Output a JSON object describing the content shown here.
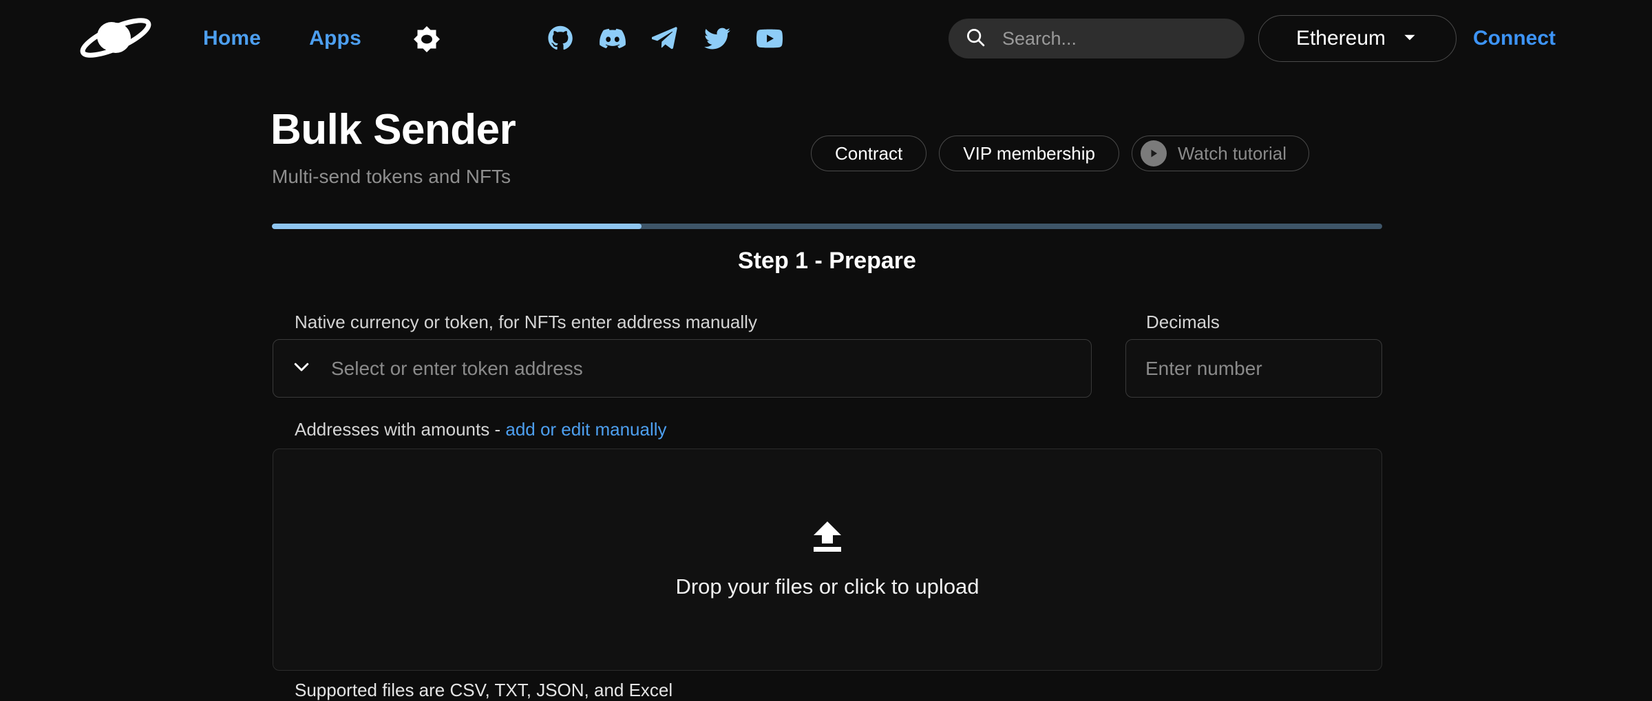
{
  "header": {
    "logo_name": "saturn-planet-logo",
    "nav": [
      {
        "label": "Home",
        "name": "nav-home"
      },
      {
        "label": "Apps",
        "name": "nav-apps"
      }
    ],
    "theme_toggle_icon": "brightness-icon",
    "socials": [
      {
        "name": "github-icon",
        "label": "GitHub"
      },
      {
        "name": "discord-icon",
        "label": "Discord"
      },
      {
        "name": "telegram-icon",
        "label": "Telegram"
      },
      {
        "name": "twitter-icon",
        "label": "Twitter"
      },
      {
        "name": "youtube-icon",
        "label": "YouTube"
      }
    ],
    "search": {
      "placeholder": "Search...",
      "value": "",
      "icon": "search-icon"
    },
    "chain": {
      "label": "Ethereum",
      "icon": "chevron-down-icon"
    },
    "connect_label": "Connect"
  },
  "page": {
    "title": "Bulk Sender",
    "subtitle": "Multi-send tokens and NFTs",
    "actions": [
      {
        "label": "Contract",
        "name": "contract-button"
      },
      {
        "label": "VIP membership",
        "name": "vip-membership-button"
      },
      {
        "label": "Watch tutorial",
        "name": "watch-tutorial-button",
        "icon": "play-icon"
      }
    ]
  },
  "progress": {
    "percent": 33,
    "percent_css": "33.3%"
  },
  "step": {
    "title": "Step 1 - Prepare"
  },
  "form": {
    "token": {
      "label": "Native currency or token, for NFTs enter address manually",
      "placeholder": "Select or enter token address",
      "value": "",
      "icon": "chevron-down-icon"
    },
    "decimals": {
      "label": "Decimals",
      "placeholder": "Enter number",
      "value": ""
    },
    "addresses": {
      "label_static": "Addresses with amounts - ",
      "label_link": "add or edit manually"
    },
    "dropzone": {
      "icon": "upload-icon",
      "text": "Drop your files or click to upload"
    },
    "supported": "Supported files are CSV, TXT, JSON, and Excel"
  },
  "colors": {
    "background": "#0d0d0d",
    "accent_blue": "#4d9fef",
    "progress_fill": "#8ec5f0",
    "progress_track": "#3e5568",
    "social_blue": "#8ecdf8"
  }
}
